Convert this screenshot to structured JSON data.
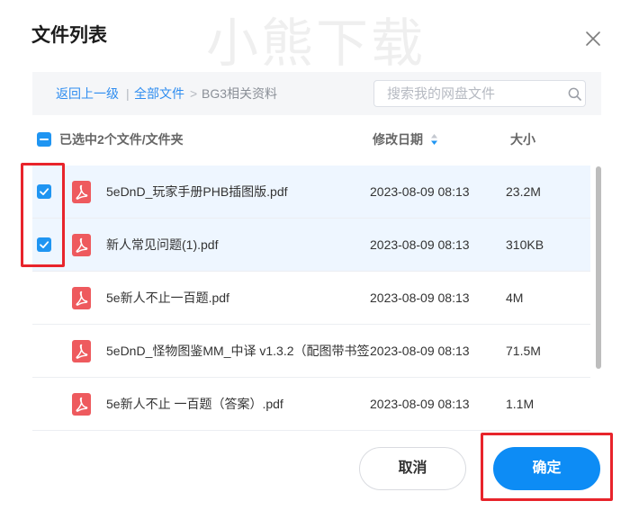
{
  "dialog": {
    "title": "文件列表",
    "watermark": "小熊下载"
  },
  "breadcrumb": {
    "back": "返回上一级",
    "divider": "|",
    "root": "全部文件",
    "arrow": ">",
    "current": "BG3相关资料"
  },
  "search": {
    "placeholder": "搜索我的网盘文件",
    "value": ""
  },
  "list_header": {
    "selection_text": "已选中2个文件/文件夹",
    "date_label": "修改日期",
    "size_label": "大小"
  },
  "files": [
    {
      "name": "5eDnD_玩家手册PHB插图版.pdf",
      "modified": "2023-08-09 08:13",
      "size": "23.2M",
      "selected": true,
      "icon": "pdf-icon"
    },
    {
      "name": "新人常见问题(1).pdf",
      "modified": "2023-08-09 08:13",
      "size": "310KB",
      "selected": true,
      "icon": "pdf-icon"
    },
    {
      "name": "5e新人不止一百题.pdf",
      "modified": "2023-08-09 08:13",
      "size": "4M",
      "selected": false,
      "icon": "pdf-icon"
    },
    {
      "name": "5eDnD_怪物图鉴MM_中译 v1.3.2（配图带书签",
      "modified": "2023-08-09 08:13",
      "size": "71.5M",
      "selected": false,
      "icon": "pdf-icon"
    },
    {
      "name": "5e新人不止 一百题（答案）.pdf",
      "modified": "2023-08-09 08:13",
      "size": "1.1M",
      "selected": false,
      "icon": "pdf-icon"
    }
  ],
  "footer": {
    "cancel_label": "取消",
    "confirm_label": "确定"
  },
  "icons": {
    "close": "close-icon",
    "search": "search-icon",
    "select_all": "minus-icon",
    "sort": "sort-desc-icon",
    "row_check": "check-icon",
    "file": "pdf-icon"
  },
  "colors": {
    "accent": "#1f95f2",
    "link": "#2f8df0",
    "selected_row": "#eef6ff",
    "confirm_button": "#0d8cf5",
    "annotation": "#e8242b",
    "pdf_icon": "#ee5a5e",
    "divider": "#eceef2"
  }
}
